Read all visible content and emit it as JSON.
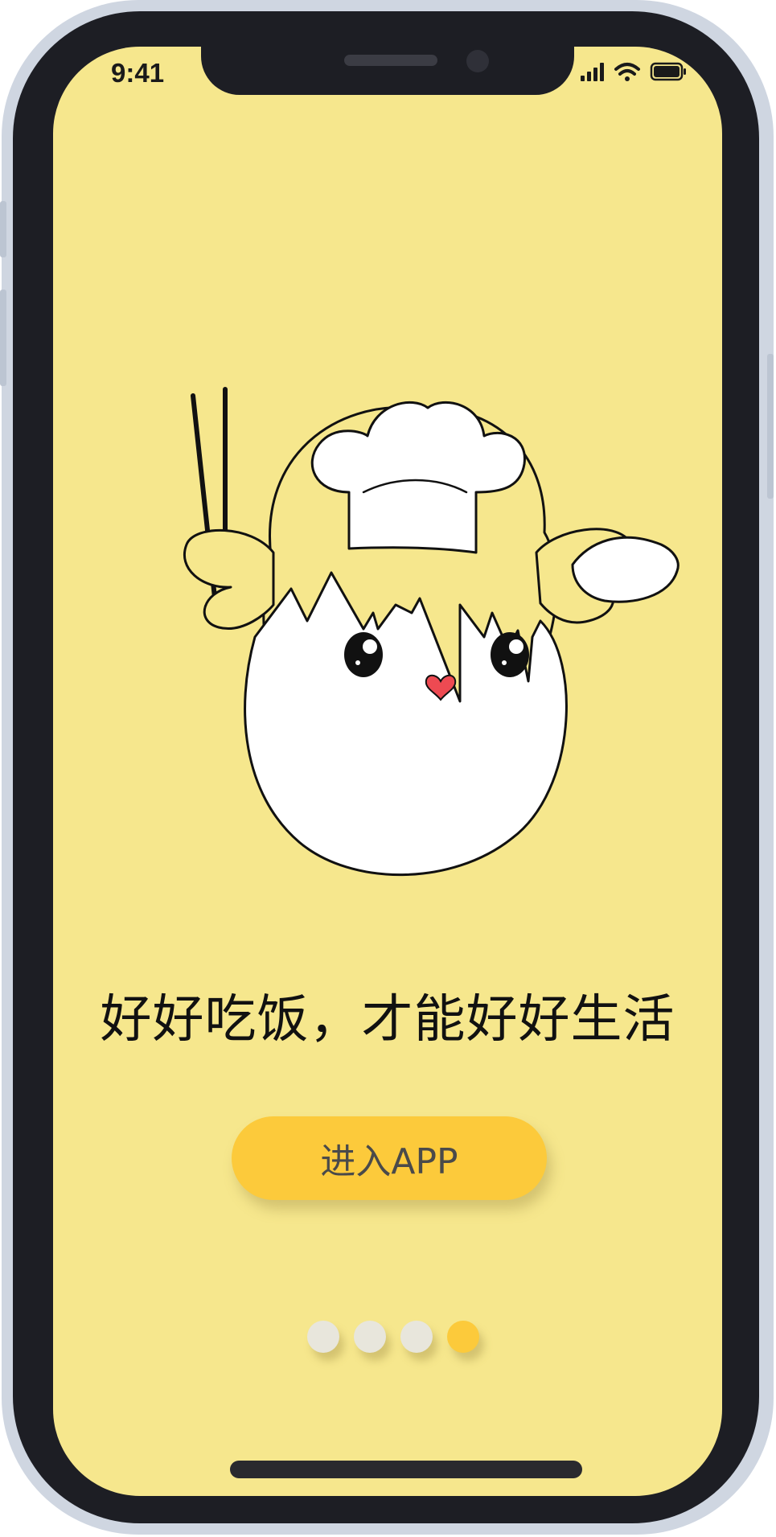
{
  "status_bar": {
    "time": "9:41",
    "icons": [
      "cellular-signal-icon",
      "wifi-icon",
      "battery-icon"
    ]
  },
  "illustration": {
    "subject": "chick-chef-illustration"
  },
  "slogan": "好好吃饭，才能好好生活",
  "enter_button": {
    "label": "进入APP"
  },
  "pagination": {
    "total": 4,
    "active_index": 3
  },
  "colors": {
    "background": "#f6e78d",
    "accent": "#fcca3b",
    "dot_inactive": "#e8e6dc",
    "chick": "#f6e78d",
    "heart": "#ee4a52"
  }
}
